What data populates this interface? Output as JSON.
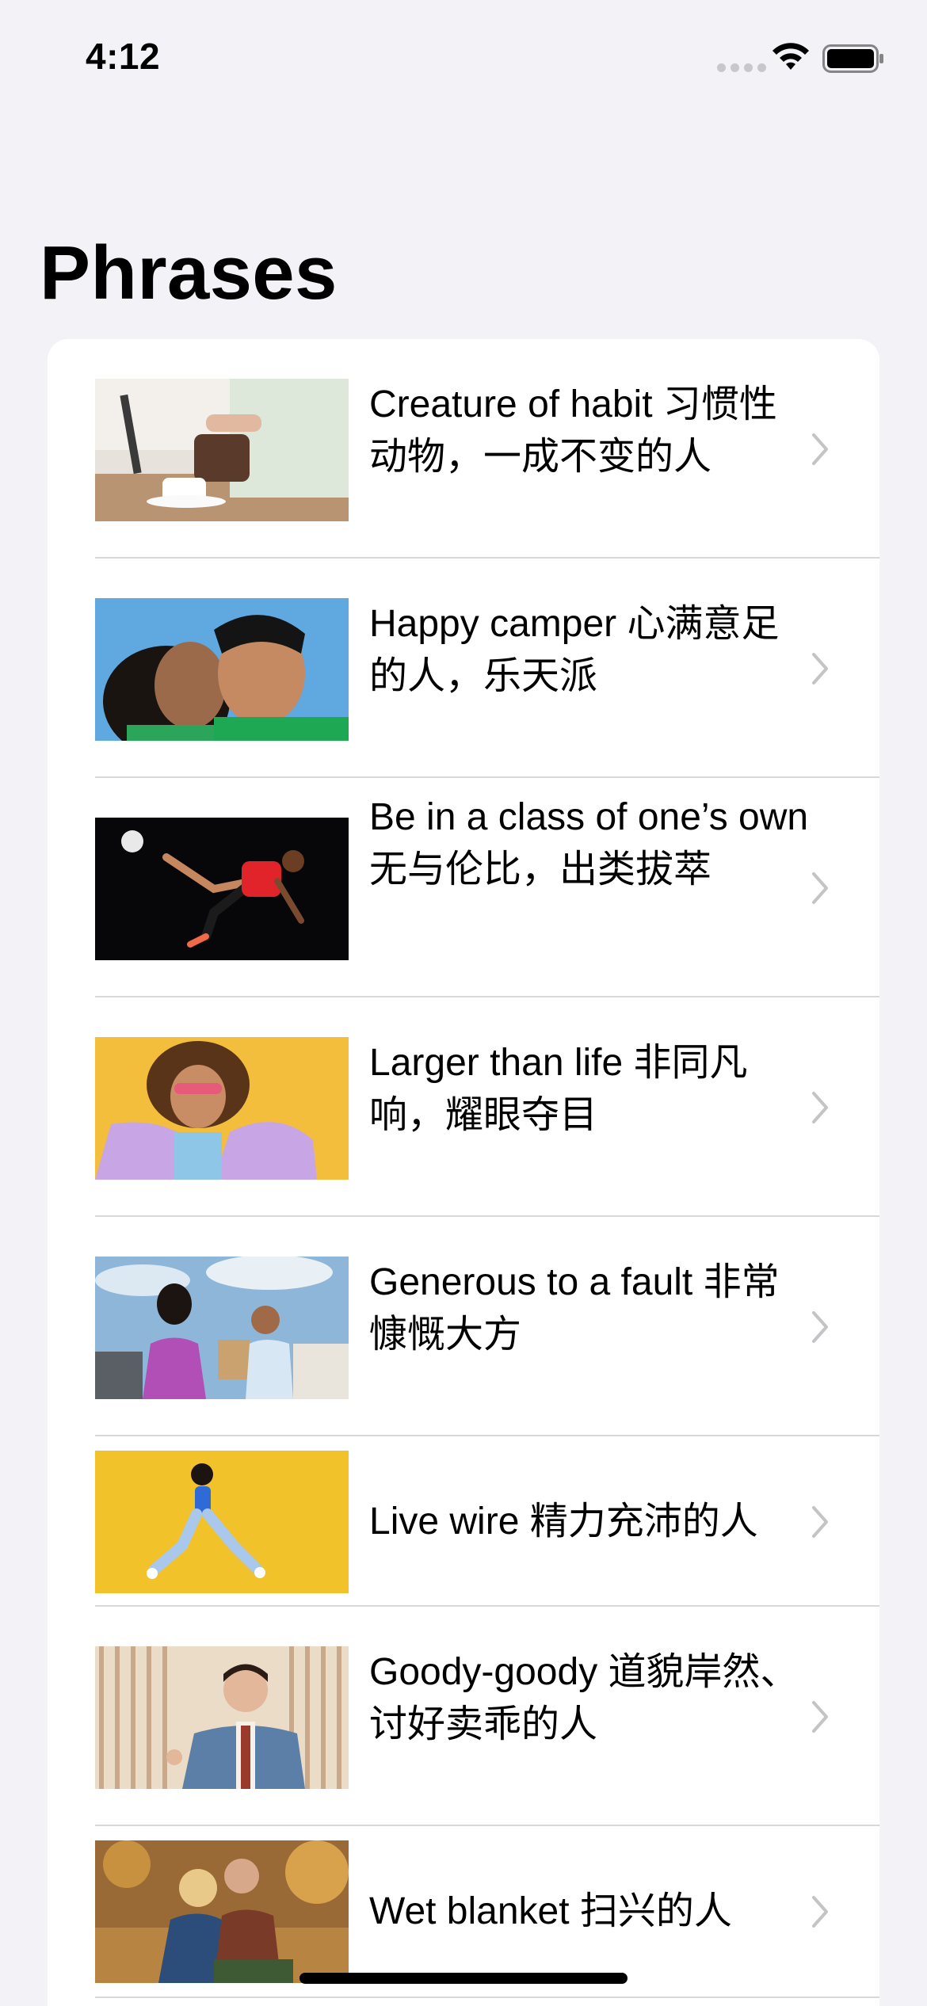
{
  "status_bar": {
    "time": "4:12"
  },
  "page": {
    "title": "Phrases"
  },
  "phrases": [
    {
      "text": "Creature of habit 习惯性动物，一成不变的人"
    },
    {
      "text": "Happy camper 心满意足的人，乐天派"
    },
    {
      "text": "Be in a class of one’s own 无与伦比，出类拔萃"
    },
    {
      "text": "Larger than life 非同凡响，耀眼夺目"
    },
    {
      "text": "Generous to a fault 非常慷慨大方"
    },
    {
      "text": "Live wire 精力充沛的人"
    },
    {
      "text": "Goody-goody 道貌岸然、讨好卖乖的人"
    },
    {
      "text": "Wet blanket 扫兴的人"
    }
  ],
  "colors": {
    "background": "#F2F2F7",
    "card": "#FFFFFF",
    "chevron": "#C4C4C7",
    "separator": "#D8D8DC"
  },
  "icons": [
    "wifi-icon",
    "battery-icon",
    "chevron-right-icon"
  ]
}
